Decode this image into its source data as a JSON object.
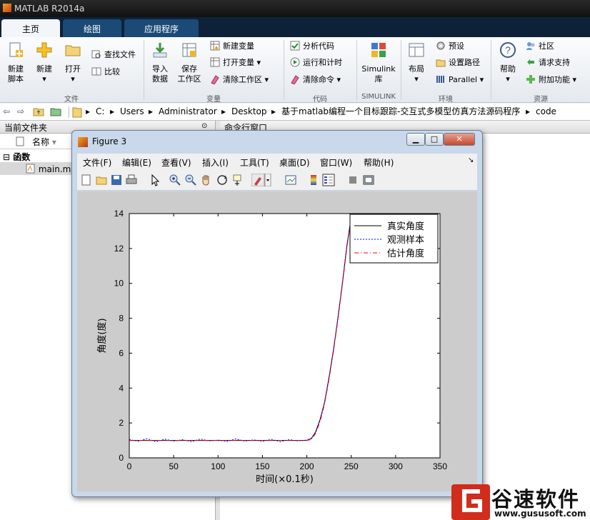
{
  "app": {
    "title": "MATLAB R2014a"
  },
  "tabs": [
    {
      "label": "主页",
      "active": true
    },
    {
      "label": "绘图",
      "active": false
    },
    {
      "label": "应用程序",
      "active": false
    }
  ],
  "ribbon": {
    "groups": [
      "文件",
      "变量",
      "代码",
      "SIMULINK",
      "环境",
      "资源"
    ],
    "file": {
      "new_script": [
        "新建",
        "脚本"
      ],
      "new": "新建",
      "open": "打开",
      "find_files": "查找文件",
      "compare": "比较"
    },
    "variable": {
      "import": [
        "导入",
        "数据"
      ],
      "save": [
        "保存",
        "工作区"
      ],
      "new_var": "新建变量",
      "open_var": "打开变量",
      "clear_ws": "清除工作区"
    },
    "code": {
      "analyze": "分析代码",
      "run_time": "运行和计时",
      "clear_cmd": "清除命令"
    },
    "simulink": {
      "label": [
        "Simulink",
        "库"
      ]
    },
    "env": {
      "layout": "布局",
      "prefs": "预设",
      "set_path": "设置路径",
      "parallel": "Parallel"
    },
    "resources": {
      "help": "帮助",
      "community": "社区",
      "support": "请求支持",
      "addons": "附加功能"
    }
  },
  "address": {
    "segments": [
      "C:",
      "Users",
      "Administrator",
      "Desktop",
      "基于matlab编程一个目标跟踪-交互式多模型仿真方法源码程序",
      "code"
    ]
  },
  "left_panel": {
    "title": "当前文件夹",
    "col_name": "名称",
    "group": "函数",
    "file": "main.m"
  },
  "right_panel": {
    "title": "命令行窗口"
  },
  "figure": {
    "title": "Figure 3",
    "menu": [
      "文件(F)",
      "编辑(E)",
      "查看(V)",
      "插入(I)",
      "工具(T)",
      "桌面(D)",
      "窗口(W)",
      "帮助(H)"
    ],
    "buttons": {
      "min": "▁",
      "max": "□",
      "close": "✕"
    }
  },
  "chart_data": {
    "type": "line",
    "xlabel": "时间(×0.1秒)",
    "ylabel": "角度(度)",
    "xlim": [
      0,
      350
    ],
    "ylim": [
      0,
      14
    ],
    "xticks": [
      0,
      50,
      100,
      150,
      200,
      250,
      300,
      350
    ],
    "yticks": [
      0,
      2,
      4,
      6,
      8,
      10,
      12,
      14
    ],
    "legend_position": "top-right",
    "series": [
      {
        "name": "真实角度",
        "color": "#000000",
        "style": "solid",
        "x": [
          0,
          200,
          205,
          210,
          215,
          220,
          225,
          230,
          235,
          240,
          245,
          250,
          255
        ],
        "y": [
          1,
          1,
          1.1,
          1.5,
          2.2,
          3.2,
          4.6,
          6.2,
          8.0,
          10.0,
          12.1,
          13.8,
          13.9
        ]
      },
      {
        "name": "观测样本",
        "color": "#0000ff",
        "style": "dotted",
        "x": [
          0,
          10,
          20,
          30,
          40,
          50,
          60,
          70,
          80,
          90,
          100,
          110,
          120,
          130,
          140,
          150,
          160,
          170,
          180,
          190,
          200,
          205,
          210,
          215,
          220,
          225,
          230,
          235,
          240,
          245,
          250,
          255
        ],
        "y": [
          1.05,
          0.95,
          1.1,
          0.92,
          1.07,
          0.96,
          1.04,
          0.93,
          1.08,
          0.97,
          1.02,
          0.94,
          1.09,
          0.96,
          1.03,
          0.95,
          1.06,
          0.93,
          1.04,
          0.97,
          1.02,
          1.12,
          1.48,
          2.25,
          3.15,
          4.65,
          6.15,
          8.05,
          9.95,
          12.15,
          13.75,
          13.9
        ]
      },
      {
        "name": "估计角度",
        "color": "#ff0000",
        "style": "dashdot",
        "x": [
          0,
          200,
          205,
          210,
          215,
          220,
          225,
          230,
          235,
          240,
          245,
          250,
          255
        ],
        "y": [
          1,
          1,
          1.05,
          1.4,
          2.1,
          3.1,
          4.5,
          6.1,
          7.9,
          9.9,
          12.0,
          13.7,
          14.0
        ]
      }
    ]
  },
  "watermark": {
    "text": "谷速软件",
    "url": "www.gususoft.com"
  }
}
